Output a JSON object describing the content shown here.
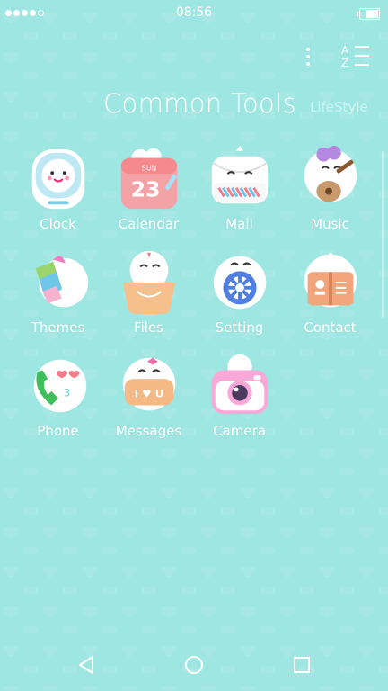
{
  "status": {
    "time": "08:56",
    "signal_bars": 5,
    "signal_filled": 4
  },
  "header": {
    "title": "Common Tools",
    "subtitle": "LifeStyle"
  },
  "apps": [
    {
      "label": "Clock",
      "icon": "clock-icon",
      "color": "#bfe8f5"
    },
    {
      "label": "Calendar",
      "icon": "calendar-icon",
      "color": "#f3a3a6",
      "date": "23",
      "month": "SUN"
    },
    {
      "label": "Mail",
      "icon": "mail-icon",
      "color": "#f7f7f7"
    },
    {
      "label": "Music",
      "icon": "music-icon",
      "color": "#c89a6b"
    },
    {
      "label": "Themes",
      "icon": "themes-icon",
      "color": "#9bd46a"
    },
    {
      "label": "Files",
      "icon": "files-icon",
      "color": "#f6c08c"
    },
    {
      "label": "Setting",
      "icon": "setting-icon",
      "color": "#4f7fe0"
    },
    {
      "label": "Contact",
      "icon": "contact-icon",
      "color": "#f2a47a"
    },
    {
      "label": "Phone",
      "icon": "phone-icon",
      "color": "#3fbf5a"
    },
    {
      "label": "Messages",
      "icon": "messages-icon",
      "color": "#f4b985",
      "text": "I ♥ U"
    },
    {
      "label": "Camera",
      "icon": "camera-icon",
      "color": "#f9a8d8"
    }
  ],
  "nav": {
    "back": "back-icon",
    "home": "home-icon",
    "recents": "recents-icon"
  },
  "colors": {
    "background": "#9ee6e2",
    "text": "#ffffff"
  }
}
